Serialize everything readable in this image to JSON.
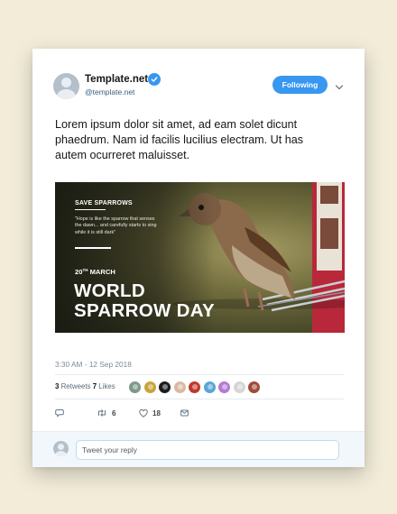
{
  "profile": {
    "name": "Template.net",
    "handle": "@template.net",
    "follow_label": "Following"
  },
  "tweet": {
    "text": "Lorem ipsum dolor sit amet, ad eam solet dicunt phaedrum. Nam id facilis lucilius electram. Ut has autem ocurreret maluisset.",
    "timestamp": "3:30 AM - 12 Sep 2018"
  },
  "media": {
    "kicker": "SAVE SPARROWS",
    "quote": "\"Hope is like the sparrow that senses\nthe dawn... and carefully starts to sing\nwhile it is still dark\"",
    "date_day": "20",
    "date_suffix": "TH",
    "date_month": " MARCH",
    "headline": "WORLD\nSPARROW DAY"
  },
  "stats": {
    "retweets_count": "3",
    "retweets_label": "Retweets",
    "likes_count": "7",
    "likes_label": "Likes",
    "liker_colors": [
      "#7d9a86",
      "#c7a43c",
      "#1d1d1d",
      "#d8b9a4",
      "#c0392b",
      "#5aa6d6",
      "#b57ad6",
      "#d6d6d6",
      "#a14a3a"
    ]
  },
  "actions": {
    "reply_icon": "reply-icon",
    "retweet_count": "6",
    "like_count": "18",
    "dm_icon": "envelope-icon"
  },
  "reply": {
    "placeholder": "Tweet your reply"
  },
  "colors": {
    "accent": "#3897f0",
    "background": "#f2ecd9"
  }
}
